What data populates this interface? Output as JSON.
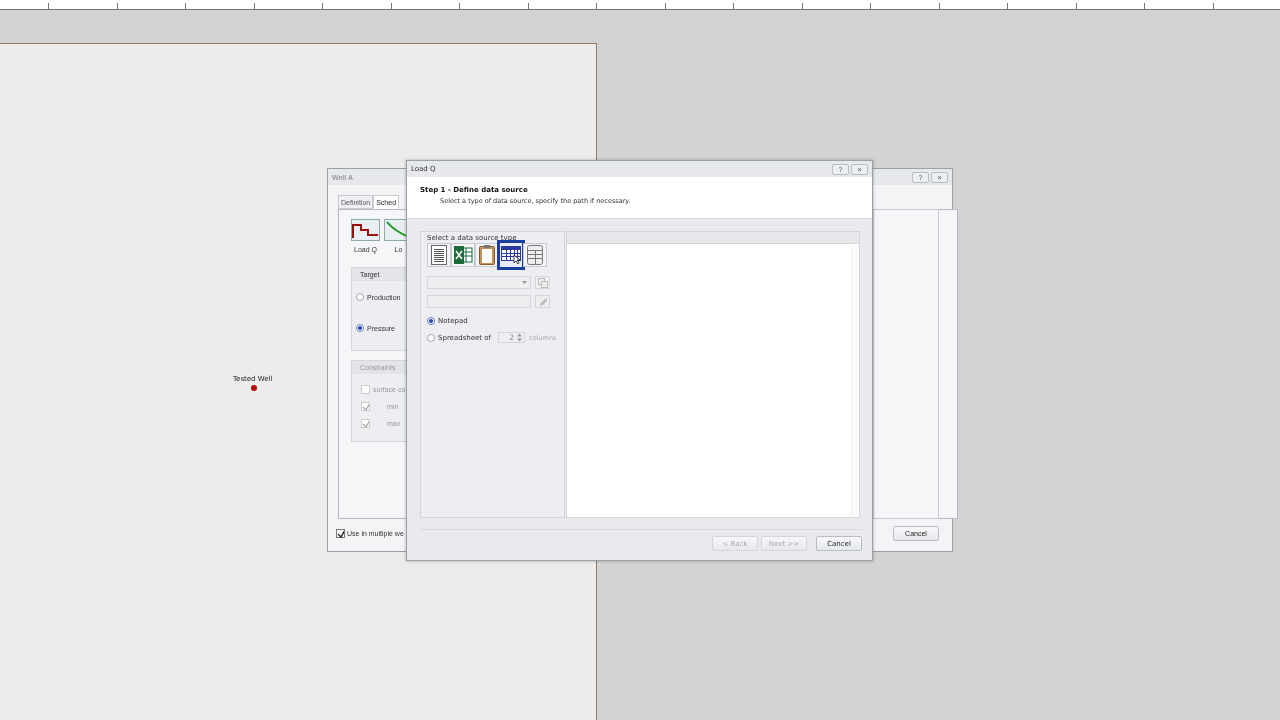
{
  "canvas": {
    "well_label": "Tested Well"
  },
  "well_window": {
    "title": "Well A",
    "title_buttons": [
      "?",
      "×"
    ],
    "tabs": [
      {
        "label": "Definition",
        "selected": false
      },
      {
        "label": "Sched",
        "selected": true
      }
    ],
    "tools": [
      {
        "label": "Load Q",
        "kind": "rate"
      },
      {
        "label": "Lo",
        "kind": "decline"
      }
    ],
    "target": {
      "title": "Target",
      "options": [
        {
          "label": "Production",
          "selected": false
        },
        {
          "label": "Pressure",
          "selected": true
        }
      ]
    },
    "constraints": {
      "title": "Constraints",
      "items": [
        {
          "label": "surface co",
          "checked": false
        },
        {
          "label": "min",
          "checked": true
        },
        {
          "label": "max",
          "checked": true
        }
      ]
    },
    "use_multiple": {
      "label": "Use in multiple we",
      "checked": true
    },
    "buttons": [
      "Cancel"
    ]
  },
  "dialog": {
    "title": "Load Q",
    "title_buttons": [
      "?",
      "×"
    ],
    "step_title": "Step 1 - Define data source",
    "step_hint": "Select a type of data source, specify the path if necessary.",
    "source_group": "Select a data source type",
    "source_types": [
      {
        "kind": "text",
        "selected": false
      },
      {
        "kind": "excel",
        "selected": false
      },
      {
        "kind": "clipboard",
        "selected": false
      },
      {
        "kind": "grid",
        "selected": true
      },
      {
        "kind": "database",
        "selected": false
      }
    ],
    "options": [
      {
        "label": "Notepad",
        "selected": true
      },
      {
        "label": "Spreadsheet of",
        "selected": false
      }
    ],
    "columns_value": "2",
    "columns_label": "columns",
    "buttons": [
      {
        "label": "< Back",
        "disabled": true
      },
      {
        "label": "Next >>",
        "disabled": true
      },
      {
        "label": "Cancel",
        "disabled": false
      }
    ]
  }
}
